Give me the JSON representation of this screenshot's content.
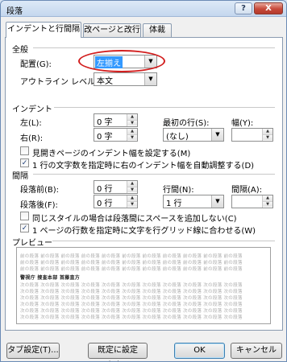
{
  "window": {
    "title": "段落",
    "help_label": "?",
    "close_label": "X"
  },
  "tabs": [
    {
      "label": "インデントと行間隔",
      "active": true
    },
    {
      "label": "改ページと改行",
      "active": false
    },
    {
      "label": "体裁",
      "active": false
    }
  ],
  "general": {
    "heading": "全般",
    "alignment_label": "配置(G):",
    "alignment_value": "左揃え",
    "outline_label": "アウトライン レベル(O):",
    "outline_value": "本文"
  },
  "indent": {
    "heading": "インデント",
    "left_label": "左(L):",
    "left_value": "0 字",
    "right_label": "右(R):",
    "right_value": "0 字",
    "first_line_label": "最初の行(S):",
    "first_line_value": "(なし)",
    "width_label": "幅(Y):",
    "width_value": "",
    "mirror_label": "見開きページのインデント幅を設定する(M)",
    "mirror_checked": false,
    "auto_adjust_label": "1 行の文字数を指定時に右のインデント幅を自動調整する(D)",
    "auto_adjust_checked": true
  },
  "spacing": {
    "heading": "間隔",
    "before_label": "段落前(B):",
    "before_value": "0 行",
    "after_label": "段落後(F):",
    "after_value": "0 行",
    "line_spacing_label": "行間(N):",
    "line_spacing_value": "1 行",
    "at_label": "間隔(A):",
    "at_value": "",
    "no_space_label": "同じスタイルの場合は段落間にスペースを追加しない(C)",
    "no_space_checked": false,
    "grid_label": "1 ページの行数を指定時に文字を行グリッド線に合わせる(W)",
    "grid_checked": true
  },
  "preview": {
    "heading": "プレビュー",
    "prev_paragraph": "前の段落 前の段落 前の段落 前の段落 前の段落 前の段落 前の段落 前の段落 前の段落 前の段落 前の段落",
    "current_paragraph": "警視庁 捜査本部 首藤直方",
    "next_paragraph": "次の段落 次の段落 次の段落 次の段落 次の段落 次の段落 次の段落 次の段落 次の段落 次の段落 次の段落"
  },
  "buttons": {
    "tabs": "タブ設定(T)...",
    "default": "既定に設定(D)...",
    "ok": "OK",
    "cancel": "キャンセル"
  },
  "annotation_color": "#d21f1f"
}
